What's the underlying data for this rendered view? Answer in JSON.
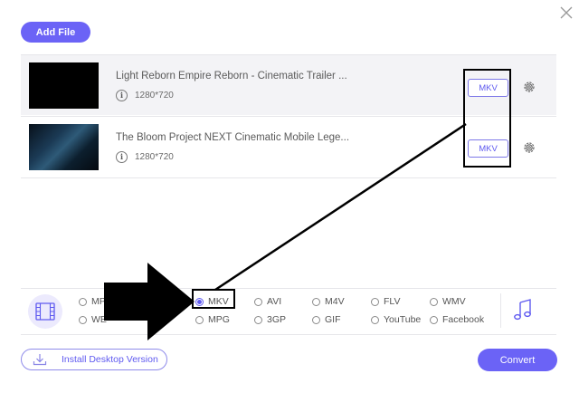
{
  "toolbar": {
    "add_file_label": "Add File"
  },
  "files": [
    {
      "title": "Light Reborn Empire Reborn - Cinematic Trailer ...",
      "resolution": "1280*720",
      "format": "MKV"
    },
    {
      "title": "The Bloom Project NEXT Cinematic Mobile Lege...",
      "resolution": "1280*720",
      "format": "MKV"
    }
  ],
  "formats": {
    "selected": "MKV",
    "options": [
      {
        "label": "MP",
        "row": 0
      },
      {
        "label": "WE",
        "row": 1
      },
      {
        "label": "MKV",
        "row": 0
      },
      {
        "label": "MPG",
        "row": 1
      },
      {
        "label": "AVI",
        "row": 0
      },
      {
        "label": "3GP",
        "row": 1
      },
      {
        "label": "M4V",
        "row": 0
      },
      {
        "label": "GIF",
        "row": 1
      },
      {
        "label": "FLV",
        "row": 0
      },
      {
        "label": "YouTube",
        "row": 1
      },
      {
        "label": "WMV",
        "row": 0
      },
      {
        "label": "Facebook",
        "row": 1
      }
    ]
  },
  "footer": {
    "install_label": "Install Desktop Version",
    "convert_label": "Convert"
  },
  "colors": {
    "accent": "#6b63f6",
    "annotation": "#000000"
  },
  "icons": [
    "close-icon",
    "info-icon",
    "gear-icon",
    "film-icon",
    "music-note-icon",
    "download-icon"
  ]
}
